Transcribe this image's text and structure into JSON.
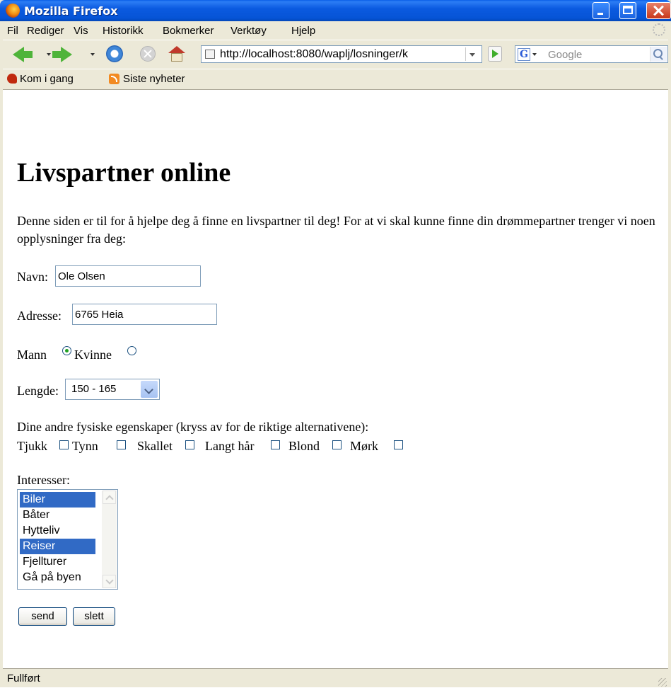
{
  "window": {
    "title": "Mozilla Firefox"
  },
  "menu": [
    "Fil",
    "Rediger",
    "Vis",
    "Historikk",
    "Bokmerker",
    "Verktøy",
    "Hjelp"
  ],
  "toolbar": {
    "url": "http://localhost:8080/waplj/losninger/k",
    "search_placeholder": "Google"
  },
  "bookmarks": [
    "Kom i gang",
    "Siste nyheter"
  ],
  "page": {
    "heading": "Livspartner online",
    "intro": "Denne siden er til for å hjelpe deg å finne en livspartner til deg! For at vi skal kunne finne din drømmepartner trenger vi noen opplysninger fra deg:",
    "name_label": "Navn:",
    "name_value": "Ole Olsen",
    "address_label": "Adresse:",
    "address_value": "6765 Heia",
    "gender": {
      "male_label": "Mann",
      "female_label": "Kvinne",
      "selected": "Mann"
    },
    "height_label": "Lengde:",
    "height_value": "150 - 165",
    "traits_prompt": "Dine andre fysiske egenskaper (kryss av for de riktige alternativene):",
    "traits": [
      "Tjukk",
      "Tynn",
      "Skallet",
      "Langt hår",
      "Blond",
      "Mørk"
    ],
    "interests_label": "Interesser:",
    "interests": [
      {
        "label": "Biler",
        "selected": true
      },
      {
        "label": "Båter",
        "selected": false
      },
      {
        "label": "Hytteliv",
        "selected": false
      },
      {
        "label": "Reiser",
        "selected": true
      },
      {
        "label": "Fjellturer",
        "selected": false
      },
      {
        "label": "Gå på byen",
        "selected": false
      }
    ],
    "send_label": "send",
    "reset_label": "slett"
  },
  "status": {
    "text": "Fullført"
  },
  "colors": {
    "titlebar": "#0654d6",
    "selection": "#316ac5",
    "chrome": "#ece9d8"
  }
}
